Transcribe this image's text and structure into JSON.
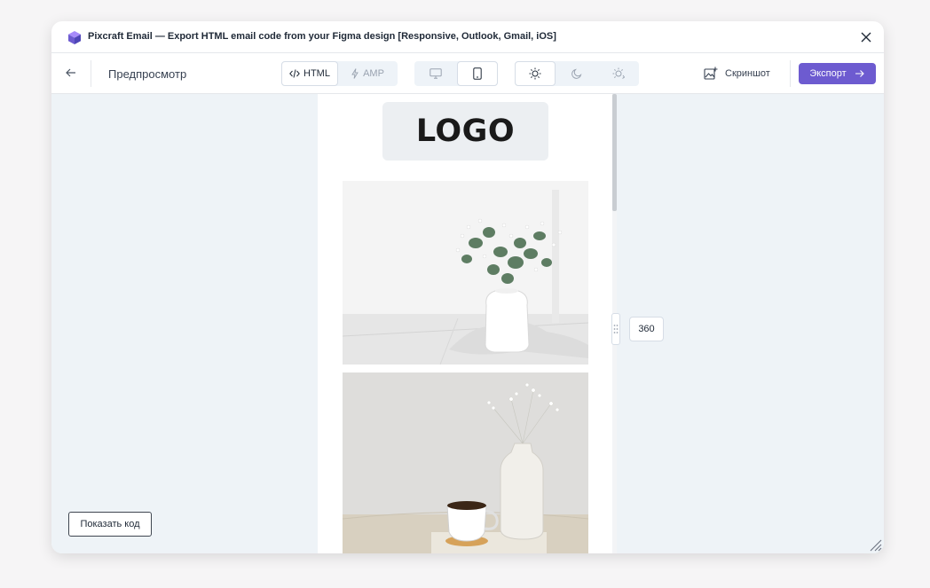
{
  "window": {
    "title": "Pixcraft Email — Export HTML email code from your Figma design [Responsive, Outlook, Gmail, iOS]",
    "app_icon": "pixcraft-cube-icon",
    "close_icon": "close-icon"
  },
  "toolbar": {
    "back_icon": "arrow-left-icon",
    "page_title": "Предпросмотр",
    "format_tabs": [
      {
        "label": "HTML",
        "icon": "code-icon",
        "active": true
      },
      {
        "label": "AMP",
        "icon": "bolt-icon",
        "active": false
      }
    ],
    "device_toggle": [
      {
        "icon": "desktop-icon",
        "active": false
      },
      {
        "icon": "mobile-icon",
        "active": true
      }
    ],
    "theme_toggle": [
      {
        "icon": "sun-icon",
        "active": true
      },
      {
        "icon": "moon-icon",
        "active": false
      },
      {
        "icon": "auto-theme-icon",
        "active": false
      }
    ],
    "screenshot_label": "Скриншот",
    "screenshot_icon": "image-add-icon",
    "export_label": "Экспорт",
    "export_icon": "arrow-right-icon",
    "accent_color": "#6d5bd0"
  },
  "preview": {
    "logo_text": "LOGO",
    "width_value": "360",
    "show_code_label": "Показать код",
    "photos": [
      {
        "name": "vase-with-eucalyptus-photo"
      },
      {
        "name": "coffee-cup-and-vase-photo"
      }
    ]
  }
}
